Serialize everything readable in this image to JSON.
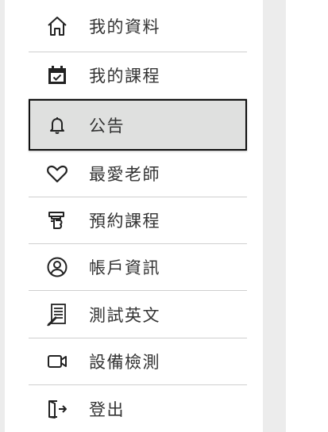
{
  "menu": {
    "items": [
      {
        "label": "我的資料",
        "icon": "home-icon"
      },
      {
        "label": "我的課程",
        "icon": "calendar-check-icon"
      },
      {
        "label": "公告",
        "icon": "bell-icon",
        "active": true
      },
      {
        "label": "最愛老師",
        "icon": "heart-icon"
      },
      {
        "label": "預約課程",
        "icon": "booking-icon"
      },
      {
        "label": "帳戶資訊",
        "icon": "user-circle-icon"
      },
      {
        "label": "測試英文",
        "icon": "test-document-icon"
      },
      {
        "label": "設備檢測",
        "icon": "video-camera-icon"
      },
      {
        "label": "登出",
        "icon": "logout-icon"
      }
    ]
  },
  "colors": {
    "active_bg": "#dfe0df",
    "active_border": "#111111",
    "divider": "#cfcfcf"
  }
}
